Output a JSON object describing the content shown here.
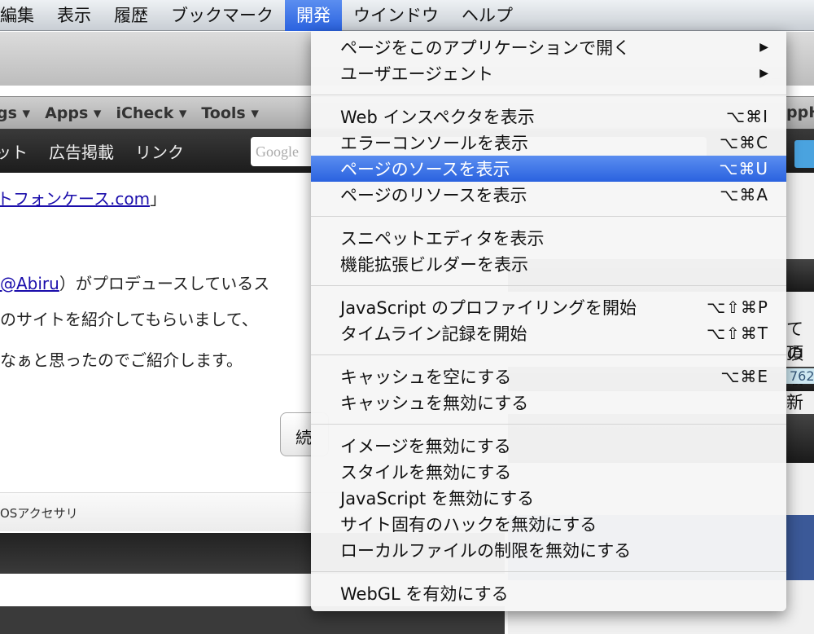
{
  "menubar": {
    "items": [
      {
        "label": "編集"
      },
      {
        "label": "表示"
      },
      {
        "label": "履歴"
      },
      {
        "label": "ブックマーク"
      },
      {
        "label": "開発",
        "active": true
      },
      {
        "label": "ウインドウ"
      },
      {
        "label": "ヘルプ"
      }
    ]
  },
  "bookmarks": {
    "items": [
      "gs ▾",
      "Apps ▾",
      "iCheck ▾",
      "Tools ▾"
    ]
  },
  "site_nav": {
    "items": [
      "ット",
      "広告掲載",
      "リンク"
    ],
    "search_placeholder": "Google"
  },
  "content": {
    "link_title": "トフォンケース.com",
    "title_suffix": "」",
    "mention": "@Abiru",
    "line1": "）がプロデュースしているス",
    "line2": "のサイトを紹介してもらいまして、",
    "line3": "なぁと思ったのでご紹介します。",
    "read_more": "続",
    "breadcrumb": "OSアクセサリ"
  },
  "sidebar": {
    "text1": "て頂",
    "text2": "の最新",
    "count": "762",
    "address_hint": "ザー",
    "partial": "ppH"
  },
  "menu": {
    "groups": [
      [
        {
          "label": "ページをこのアプリケーションで開く",
          "submenu": true
        },
        {
          "label": "ユーザエージェント",
          "submenu": true
        }
      ],
      [
        {
          "label": "Web インスペクタを表示",
          "shortcut": "⌥⌘I"
        },
        {
          "label": "エラーコンソールを表示",
          "shortcut": "⌥⌘C"
        },
        {
          "label": "ページのソースを表示",
          "shortcut": "⌥⌘U",
          "highlighted": true
        },
        {
          "label": "ページのリソースを表示",
          "shortcut": "⌥⌘A"
        }
      ],
      [
        {
          "label": "スニペットエディタを表示"
        },
        {
          "label": "機能拡張ビルダーを表示"
        }
      ],
      [
        {
          "label": "JavaScript のプロファイリングを開始",
          "shortcut": "⌥⇧⌘P"
        },
        {
          "label": "タイムライン記録を開始",
          "shortcut": "⌥⇧⌘T"
        }
      ],
      [
        {
          "label": "キャッシュを空にする",
          "shortcut": "⌥⌘E"
        },
        {
          "label": "キャッシュを無効にする"
        }
      ],
      [
        {
          "label": "イメージを無効にする"
        },
        {
          "label": "スタイルを無効にする"
        },
        {
          "label": "JavaScript を無効にする"
        },
        {
          "label": "サイト固有のハックを無効にする"
        },
        {
          "label": "ローカルファイルの制限を無効にする"
        }
      ],
      [
        {
          "label": "WebGL を有効にする"
        }
      ]
    ]
  },
  "colors": {
    "highlight": "#2f68e3",
    "menu_bg": "#f6f6f6",
    "link": "#1a0dab"
  }
}
